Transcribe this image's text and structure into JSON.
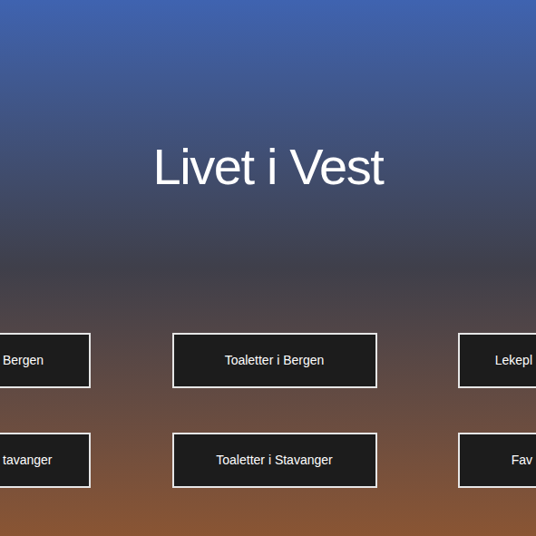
{
  "page": {
    "title": "Livet i Vest"
  },
  "button_rows": [
    {
      "buttons": [
        {
          "label": "Bergen",
          "kind": "cut-left"
        },
        {
          "label": "Toaletter i Bergen",
          "kind": "full"
        },
        {
          "label": "Lekepl",
          "kind": "cut-right"
        }
      ]
    },
    {
      "buttons": [
        {
          "label": "tavanger",
          "kind": "cut-left"
        },
        {
          "label": "Toaletter i Stavanger",
          "kind": "full"
        },
        {
          "label": "Fav",
          "kind": "cut-right"
        }
      ]
    }
  ]
}
